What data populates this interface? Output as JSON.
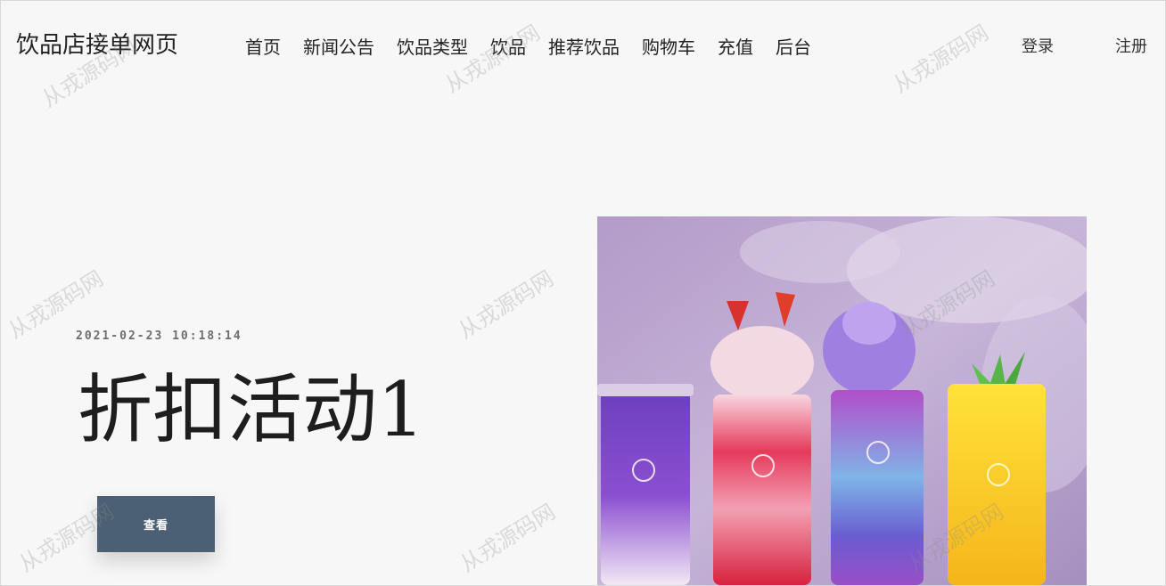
{
  "header": {
    "site_title": "饮品店接单网页",
    "nav": [
      "首页",
      "新闻公告",
      "饮品类型",
      "饮品",
      "推荐饮品",
      "购物车",
      "充值",
      "后台"
    ],
    "login_label": "登录",
    "register_label": "注册"
  },
  "hero": {
    "date": "2021-02-23 10:18:14",
    "title": "折扣活动1",
    "button_label": "查看",
    "button_color": "#4b6074"
  },
  "watermark": {
    "text": "从戎源码网"
  }
}
